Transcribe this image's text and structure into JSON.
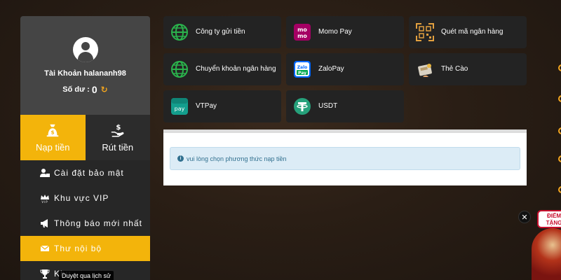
{
  "account": {
    "label_prefix": "Tài Khoản",
    "username": "halananh98",
    "full_label": "Tài Khoản halananh98",
    "balance_label": "Số dư :",
    "balance_value": "0"
  },
  "tabs": [
    {
      "label": "Nạp tiền",
      "active": true,
      "icon": "deposit-bag-icon"
    },
    {
      "label": "Rút tiền",
      "active": false,
      "icon": "withdraw-hand-icon"
    }
  ],
  "menu": [
    {
      "label": "Cài đặt bảo mật",
      "icon": "user-lock-icon"
    },
    {
      "label": "Khu vực VIP",
      "icon": "vip-crown-icon"
    },
    {
      "label": "Thông báo mới nhất",
      "icon": "megaphone-icon"
    },
    {
      "label": "Thư nội bộ",
      "icon": "envelope-icon",
      "active": true
    },
    {
      "label": "Khu",
      "icon": "trophy-icon"
    }
  ],
  "payment_methods": [
    {
      "label": "Công ty gửi tiền",
      "icon": "globe-icon"
    },
    {
      "label": "Momo Pay",
      "icon": "momo-icon"
    },
    {
      "label": "Quét mã ngân hàng",
      "icon": "qr-scan-icon"
    },
    {
      "label": "Chuyển khoản ngân hàng",
      "icon": "globe-icon"
    },
    {
      "label": "ZaloPay",
      "icon": "zalopay-icon"
    },
    {
      "label": "Thẻ Cào",
      "icon": "scratch-card-icon"
    },
    {
      "label": "VTPay",
      "icon": "vtpay-icon"
    },
    {
      "label": "USDT",
      "icon": "tether-icon"
    }
  ],
  "notice": "vui lòng chọn phương thức nạp tiền",
  "tooltip": "Duyệt qua lịch sử",
  "promo": {
    "badge_line1": "ĐIỂM",
    "badge_line2": "TẶNG"
  },
  "colors": {
    "accent": "#f3b40b",
    "sidebar": "#272727",
    "card": "#232323",
    "alert_bg": "#dcecf6",
    "alert_text": "#31708f"
  }
}
